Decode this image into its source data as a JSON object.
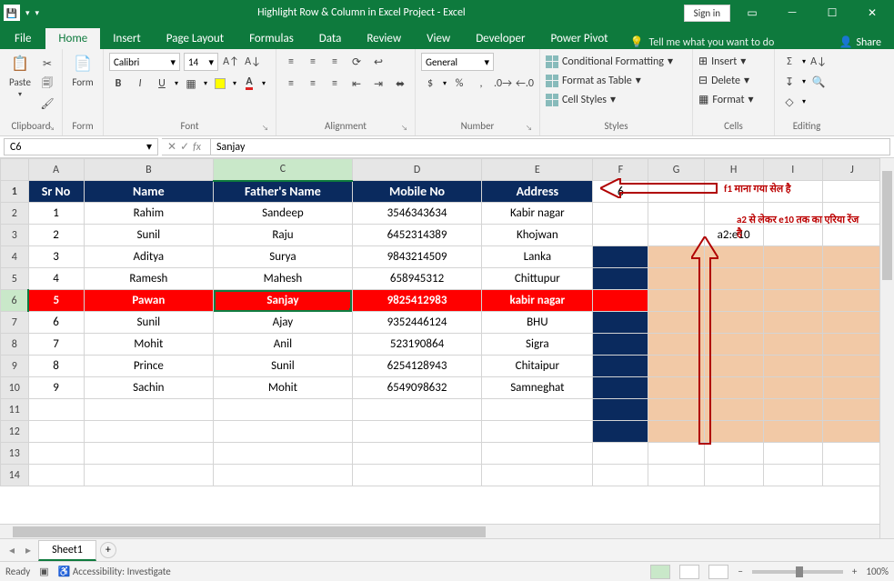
{
  "title": "Highlight Row & Column in Excel Project  -  Excel",
  "signin": "Sign in",
  "tabs": {
    "file": "File",
    "home": "Home",
    "insert": "Insert",
    "page_layout": "Page Layout",
    "formulas": "Formulas",
    "data": "Data",
    "review": "Review",
    "view": "View",
    "developer": "Developer",
    "power_pivot": "Power Pivot",
    "tell": "Tell me what you want to do",
    "share": "Share"
  },
  "ribbon": {
    "clipboard": {
      "label": "Clipboard",
      "paste": "Paste"
    },
    "form": {
      "label": "Form",
      "btn": "Form"
    },
    "font": {
      "label": "Font",
      "name": "Calibri",
      "size": "14"
    },
    "alignment": {
      "label": "Alignment"
    },
    "number": {
      "label": "Number",
      "format": "General"
    },
    "styles": {
      "label": "Styles",
      "cond": "Conditional Formatting",
      "table": "Format as Table",
      "cell": "Cell Styles"
    },
    "cells": {
      "label": "Cells",
      "insert": "Insert",
      "delete": "Delete",
      "format": "Format"
    },
    "editing": {
      "label": "Editing"
    }
  },
  "namebox": "C6",
  "formula": "Sanjay",
  "columns": [
    "A",
    "B",
    "C",
    "D",
    "E",
    "F",
    "G",
    "H",
    "I",
    "J"
  ],
  "header_row": [
    "Sr No",
    "Name",
    "Father's Name",
    "Mobile No",
    "Address"
  ],
  "f1_value": "6",
  "h3_value": "a2:e10",
  "data_rows": [
    [
      "1",
      "Rahim",
      "Sandeep",
      "3546343634",
      "Kabir nagar"
    ],
    [
      "2",
      "Sunil",
      "Raju",
      "6452314389",
      "Khojwan"
    ],
    [
      "3",
      "Aditya",
      "Surya",
      "9843214509",
      "Lanka"
    ],
    [
      "4",
      "Ramesh",
      "Mahesh",
      "658945312",
      "Chittupur"
    ],
    [
      "5",
      "Pawan",
      "Sanjay",
      "9825412983",
      "kabir nagar"
    ],
    [
      "6",
      "Sunil",
      "Ajay",
      "9352446124",
      "BHU"
    ],
    [
      "7",
      "Mohit",
      "Anil",
      "523190864",
      "Sigra"
    ],
    [
      "8",
      "Prince",
      "Sunil",
      "6254128943",
      "Chitaipur"
    ],
    [
      "9",
      "Sachin",
      "Mohit",
      "6549098632",
      "Samneghat"
    ]
  ],
  "annot": {
    "f1": "f1  माना गया सेल है",
    "range": "a2 से लेकर e10 तक का एरिया रेंज है"
  },
  "sheet_tab": "Sheet1",
  "status": {
    "ready": "Ready",
    "access": "Accessibility: Investigate",
    "zoom": "100%"
  }
}
